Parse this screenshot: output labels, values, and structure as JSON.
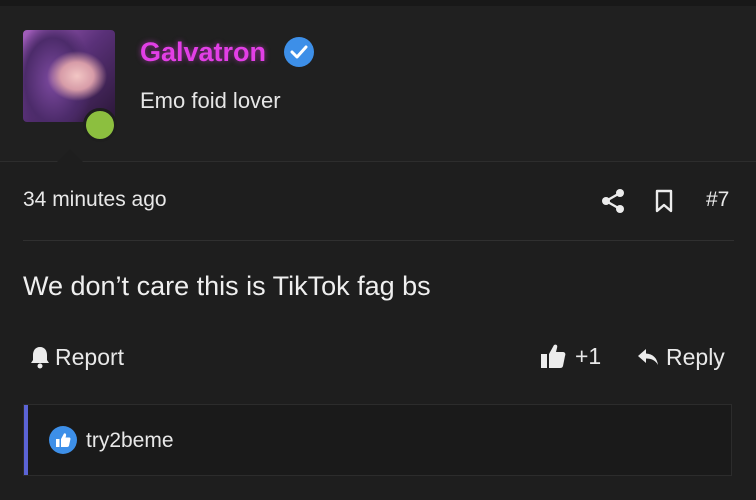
{
  "post": {
    "author": {
      "username": "Galvatron",
      "subtitle": "Emo foid lover",
      "name_color": "#e23fe6",
      "verified_icon": "verified-check-icon",
      "status_color": "#8cbf3f"
    },
    "meta": {
      "time": "34 minutes ago",
      "share_icon": "share-icon",
      "bookmark_icon": "bookmark-icon",
      "number": "#7"
    },
    "body": "We don’t care this is TikTok fag bs",
    "actions": {
      "report_label": "Report",
      "like_count": "+1",
      "reply_label": "Reply"
    },
    "reactions": {
      "accent_color": "#5b64d6",
      "icon": "like-reaction-icon",
      "users": "try2beme"
    }
  }
}
